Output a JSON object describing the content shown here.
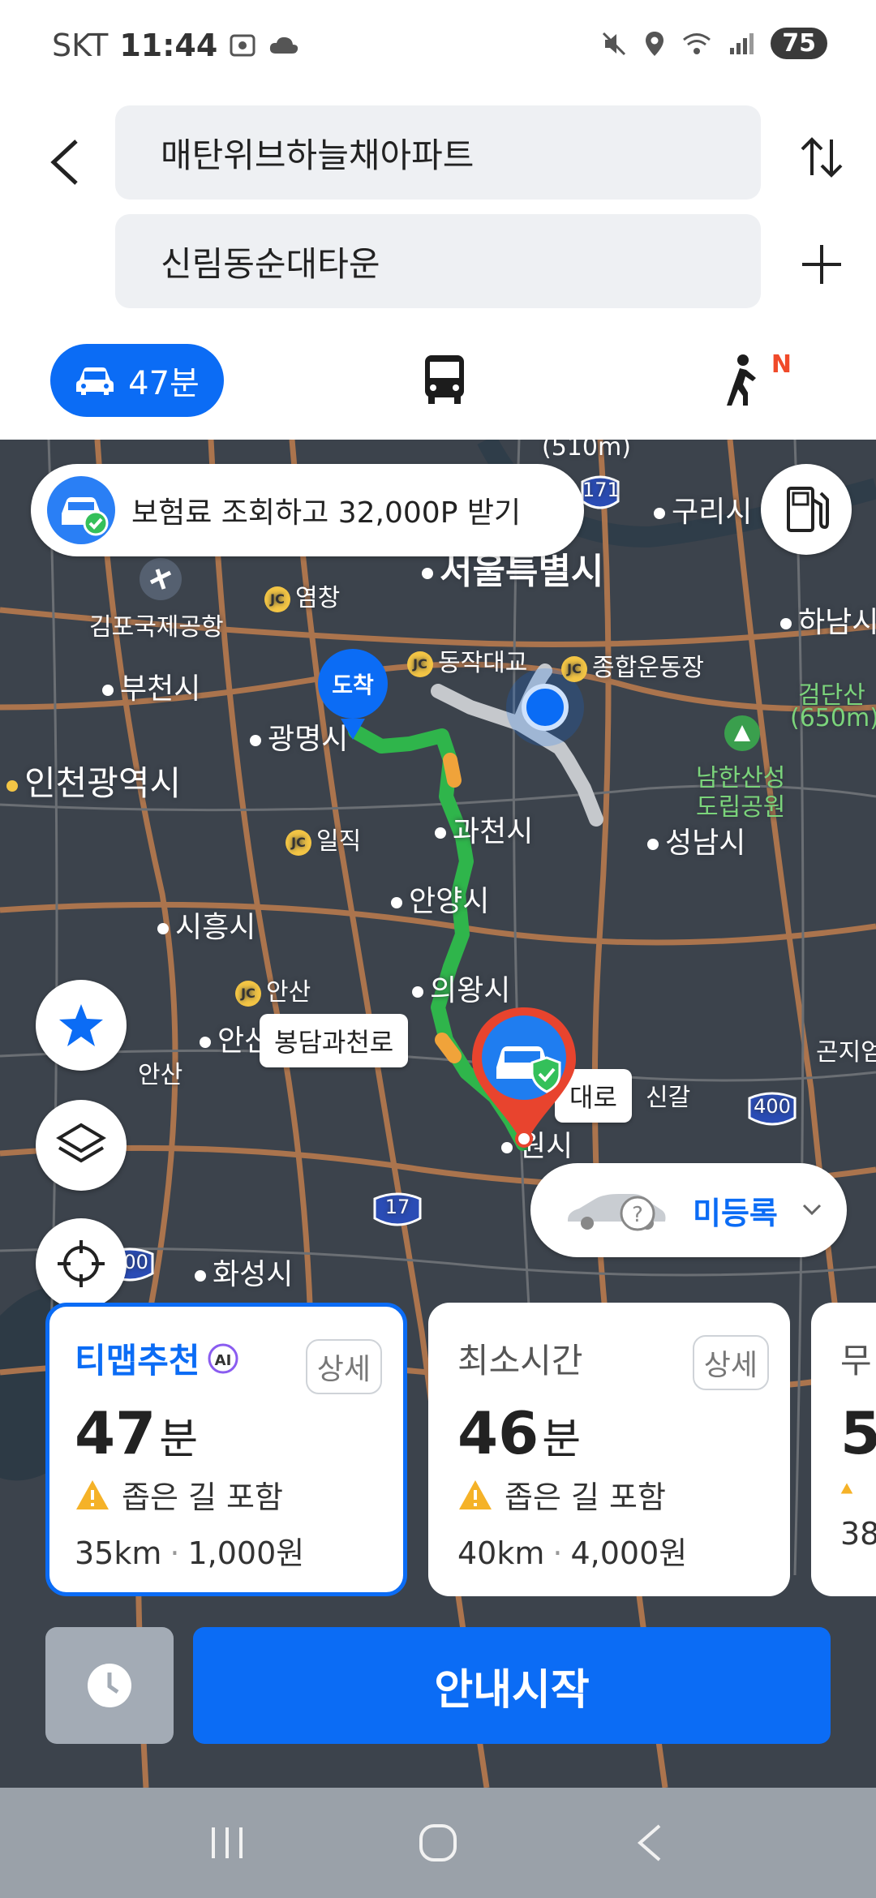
{
  "status_bar": {
    "carrier": "SKT",
    "time": "11:44",
    "battery": "75"
  },
  "search": {
    "origin": "매탄위브하늘채아파트",
    "destination": "신림동순대타운"
  },
  "modes": {
    "car_label": "47분",
    "walk_badge": "N"
  },
  "map": {
    "insurance_banner": "보험료 조회하고 32,000P 받기",
    "arrival_pin": "도착",
    "road_tag": "봉담과천로",
    "road_tag_2": "대로",
    "vehicle_status": "미등록",
    "labels": {
      "seoul": "서울특별시",
      "guri": "구리시",
      "hanam": "하남시",
      "gimpo_airport": "김포국제공항",
      "yeomchang": "염창",
      "bucheon": "부천시",
      "dongjak": "동작대교",
      "sports_complex": "종합운동장",
      "geomdansan": "검단산",
      "geomdansan_height": "(650m)",
      "gwangmyeong": "광명시",
      "incheon": "인천광역시",
      "namhansanseong": "남한산성",
      "namhansanseong_2": "도립공원",
      "gwacheon": "과천시",
      "seongnam": "성남시",
      "iljik": "일직",
      "anyang": "안양시",
      "siheung": "시흥시",
      "ansan_jc": "안산",
      "uiwang": "의왕시",
      "ansan": "안산",
      "suwon": "원시",
      "hwaseong": "화성시",
      "height_top": "(510m)",
      "gonjiam": "곤지엄",
      "singal": "신갈",
      "ansan_2": "안산"
    },
    "highway_shields": [
      "171",
      "400",
      "17",
      "400"
    ]
  },
  "routes": [
    {
      "title": "티맵추천",
      "badge": "AI",
      "detail": "상세",
      "eta_num": "47",
      "eta_unit": "분",
      "warning": "좁은 길 포함",
      "distance": "35km",
      "toll": "1,000원"
    },
    {
      "title": "최소시간",
      "detail": "상세",
      "eta_num": "46",
      "eta_unit": "분",
      "warning": "좁은 길 포함",
      "distance": "40km",
      "toll": "4,000원"
    },
    {
      "title": "무",
      "eta_num": "5",
      "distance": "38"
    }
  ],
  "actions": {
    "start": "안내시작"
  },
  "colors": {
    "accent": "#0b6cf5",
    "route": "#2fb54b",
    "map_bg": "#3c434c"
  }
}
